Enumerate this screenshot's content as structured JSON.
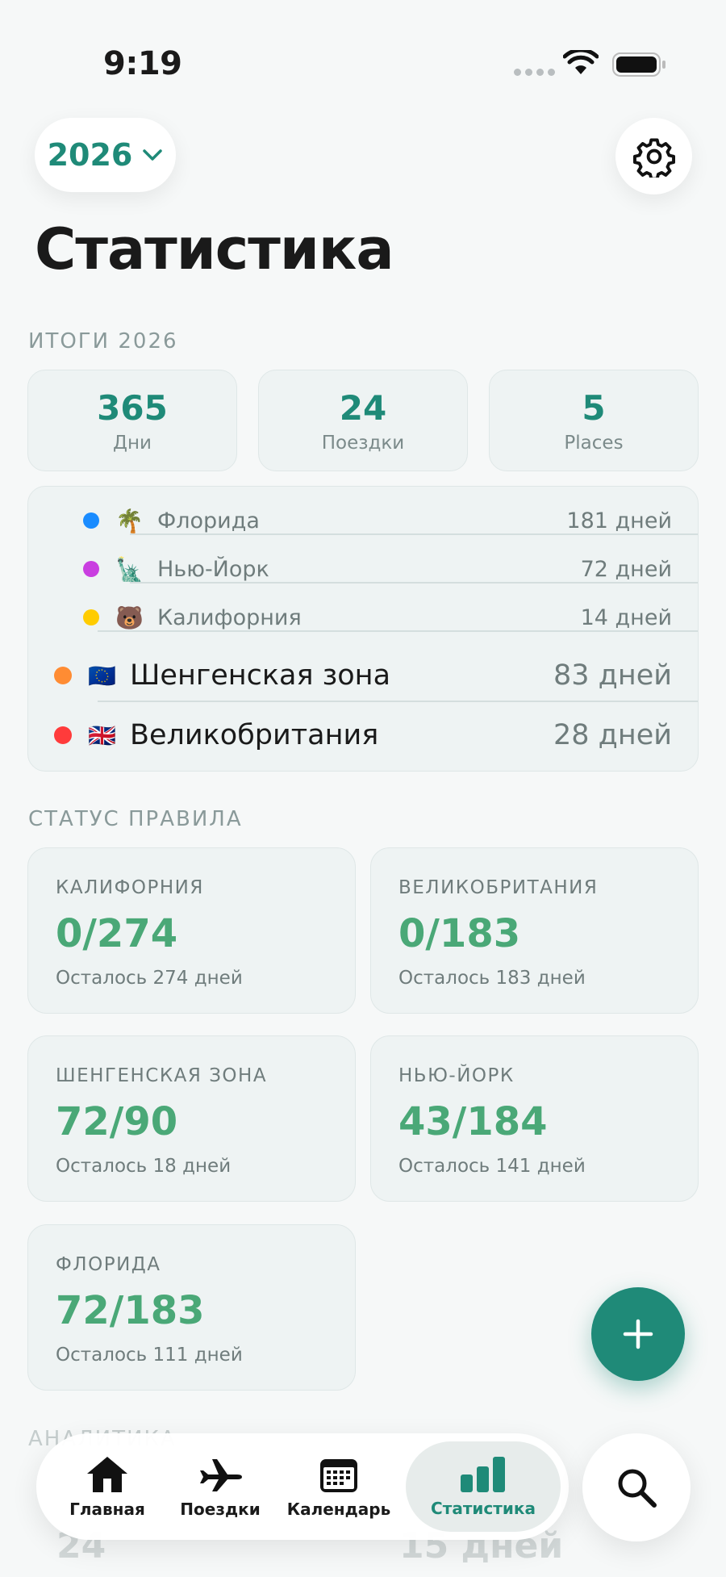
{
  "status_bar": {
    "time": "9:19"
  },
  "header": {
    "year": "2026",
    "title": "Статистика"
  },
  "summary": {
    "section_label": "ИТОГИ 2026",
    "cards": [
      {
        "value": "365",
        "label": "Дни"
      },
      {
        "value": "24",
        "label": "Поездки"
      },
      {
        "value": "5",
        "label": "Places"
      }
    ]
  },
  "regions": [
    {
      "name": "Флорида",
      "days": "181 дней",
      "emoji": "🌴",
      "dot_color": "#1a8cff",
      "level": "sub"
    },
    {
      "name": "Нью-Йорк",
      "days": "72 дней",
      "emoji": "🗽",
      "dot_color": "#c93ee0",
      "level": "sub"
    },
    {
      "name": "Калифорния",
      "days": "14 дней",
      "emoji": "🐻",
      "dot_color": "#ffcc00",
      "level": "sub"
    },
    {
      "name": "Шенгенская зона",
      "days": "83 дней",
      "emoji": "🇪🇺",
      "dot_color": "#ff8c33",
      "level": "main"
    },
    {
      "name": "Великобритания",
      "days": "28 дней",
      "emoji": "🇬🇧",
      "dot_color": "#ff3b3b",
      "level": "main"
    }
  ],
  "rules": {
    "section_label": "СТАТУС ПРАВИЛА",
    "cards": [
      {
        "name": "КАЛИФОРНИЯ",
        "value": "0/274",
        "left": "Осталось 274 дней"
      },
      {
        "name": "ВЕЛИКОБРИТАНИЯ",
        "value": "0/183",
        "left": "Осталось 183 дней"
      },
      {
        "name": "ШЕНГЕНСКАЯ ЗОНА",
        "value": "72/90",
        "left": "Осталось 18 дней"
      },
      {
        "name": "НЬЮ-ЙОРК",
        "value": "43/184",
        "left": "Осталось 141 дней"
      },
      {
        "name": "ФЛОРИДА",
        "value": "72/183",
        "left": "Осталось 111 дней"
      }
    ]
  },
  "analytics": {
    "section_label": "АНАЛИТИКА",
    "value_1": "24",
    "value_2": "15 дней"
  },
  "tabbar": {
    "tabs": [
      {
        "label": "Главная",
        "icon": "home-icon"
      },
      {
        "label": "Поездки",
        "icon": "airplane-icon"
      },
      {
        "label": "Календарь",
        "icon": "calendar-icon"
      },
      {
        "label": "Статистика",
        "icon": "bar-chart-icon",
        "active": true
      }
    ]
  },
  "colors": {
    "accent": "#1f8a78",
    "rule_value": "#4aa877"
  }
}
